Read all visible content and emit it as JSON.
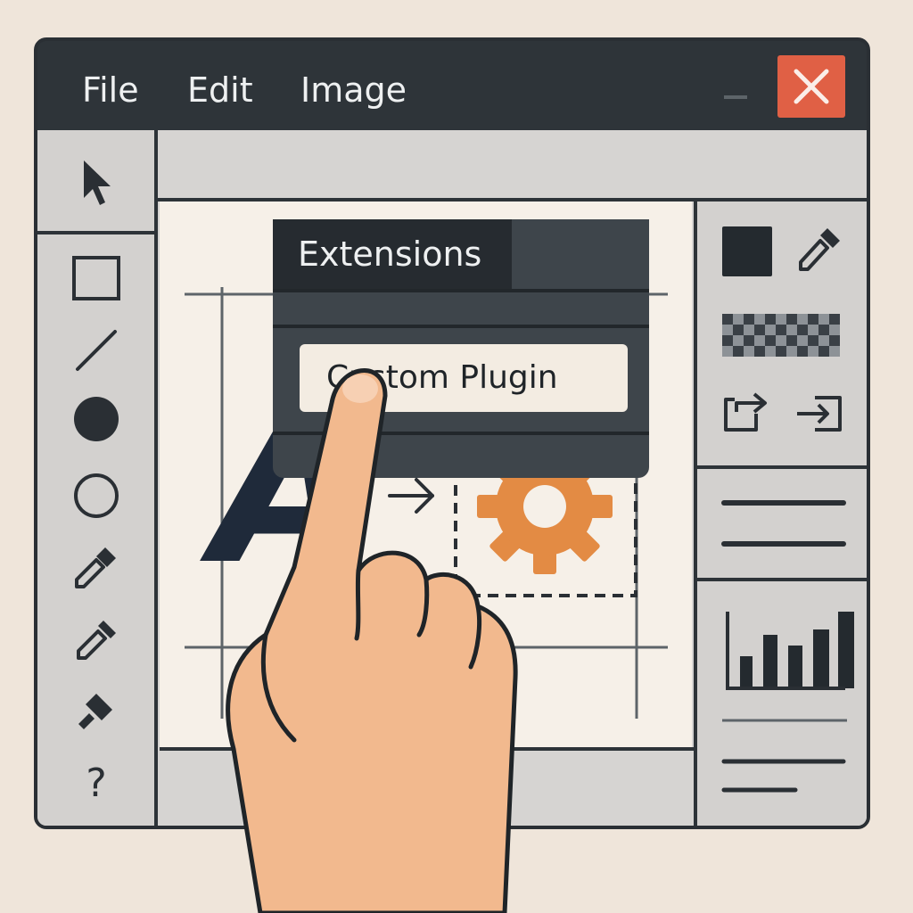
{
  "menubar": {
    "items": [
      {
        "label": "File"
      },
      {
        "label": "Edit"
      },
      {
        "label": "Image"
      }
    ]
  },
  "dropdown": {
    "header": "Extensions",
    "items": [
      {
        "label": "Custom Plugin"
      }
    ]
  },
  "canvas": {
    "letter": "A",
    "letter_color": "#1f2a3a",
    "gear_color": "#e38b44"
  },
  "colors": {
    "close_button": "#e06045",
    "window_frame": "#2d3338",
    "background": "#efe5da",
    "skin": "#f2b98e"
  },
  "left_toolbar": {
    "icons": [
      "cursor-arrow-icon",
      "rectangle-icon",
      "line-icon",
      "filled-circle-icon",
      "circle-icon",
      "brush-icon",
      "eyedropper-icon",
      "fill-bucket-icon",
      "help-icon"
    ],
    "help_glyph": "?"
  },
  "right_panel": {
    "icons": [
      "color-swatch-icon",
      "eyedropper-icon",
      "transparency-pattern-icon",
      "export-icon",
      "import-icon",
      "properties-lines-icon",
      "histogram-icon",
      "text-lines-icon"
    ]
  }
}
